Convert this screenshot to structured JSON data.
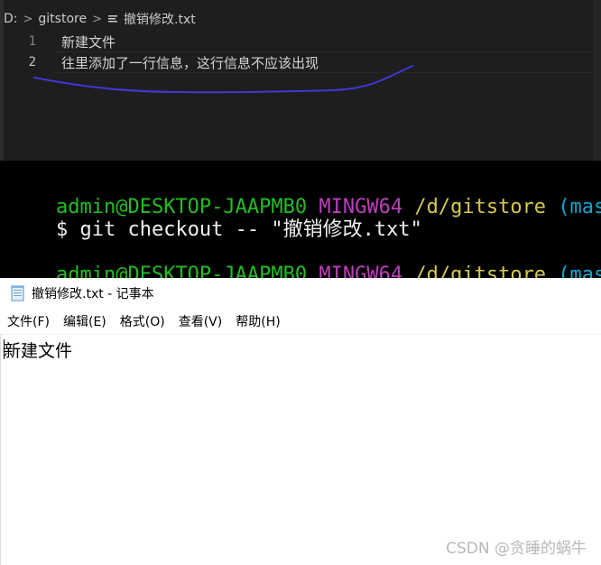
{
  "editor": {
    "breadcrumb": {
      "drive": "D:",
      "folder": "gitstore",
      "separator": ">",
      "file": "撤销修改.txt",
      "file_icon": "text-file-icon"
    },
    "lines": [
      {
        "number": "1",
        "text": "新建文件"
      },
      {
        "number": "2",
        "text": "往里添加了一行信息，这行信息不应该出现"
      }
    ],
    "annotation_color": "#3b3bd8"
  },
  "terminal": {
    "prompt1": {
      "user": "admin@DESKTOP-JAAPMB0",
      "env": "MINGW64",
      "path": "/d/gitstore",
      "branch": "(mast"
    },
    "command": {
      "symbol": "$",
      "text": "git checkout -- \"撤销修改.txt\""
    },
    "prompt2": {
      "user": "admin@DESKTOP-JAAPMB0",
      "env": "MINGW64",
      "path": "/d/gitstore",
      "branch": "(mast"
    },
    "input": {
      "symbol": "$"
    }
  },
  "notepad": {
    "title": "撤销修改.txt - 记事本",
    "app_icon": "notepad-icon",
    "menu": [
      "文件(F)",
      "编辑(E)",
      "格式(O)",
      "查看(V)",
      "帮助(H)"
    ],
    "content": "新建文件"
  },
  "watermark": "CSDN @贪睡的蜗牛"
}
